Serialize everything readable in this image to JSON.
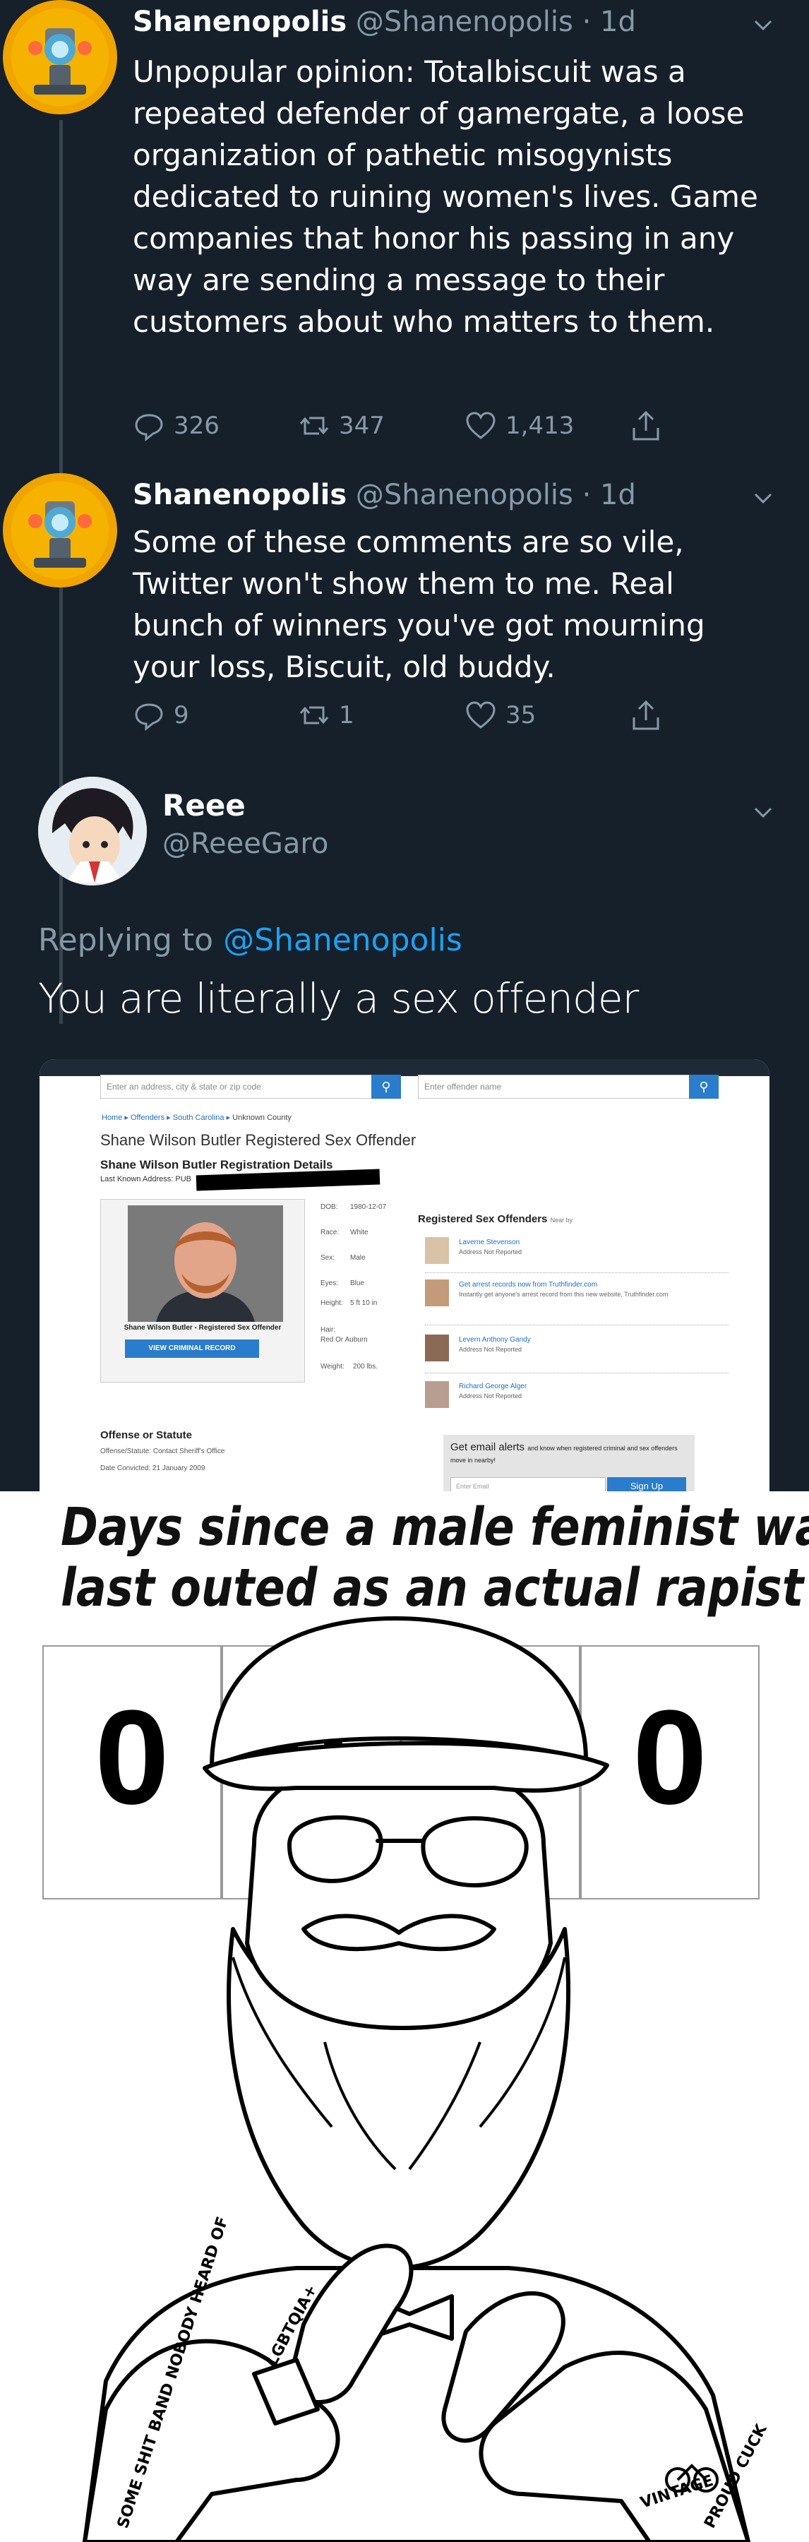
{
  "tweets": [
    {
      "name": "Shanenopolis",
      "handle": "@Shanenopolis",
      "time": "· 1d",
      "text": "Unpopular opinion: Totalbiscuit was a repeated defender of gamergate, a loose organization of pathetic misogynists dedicated to ruining women's lives. Game companies that honor his passing in any way are sending a message to their customers about who matters to them.",
      "replies": "326",
      "retweets": "347",
      "likes": "1,413"
    },
    {
      "name": "Shanenopolis",
      "handle": "@Shanenopolis",
      "time": "· 1d",
      "text": "Some of these comments are so vile, Twitter won't show them to me. Real bunch of winners you've got mourning your loss, Biscuit, old buddy.",
      "replies": "9",
      "retweets": "1",
      "likes": "35"
    }
  ],
  "reply": {
    "name": "Reee",
    "handle": "@ReeeGaro",
    "replying_prefix": "Replying to",
    "replying_to": "@Shanenopolis",
    "text": "You are literally a sex offender"
  },
  "embed": {
    "search_placeholder": "Enter an address, city & state or zip code",
    "offender_placeholder": "Enter offender name",
    "breadcrumb": [
      "Home",
      "Offenders",
      "South Carolina",
      "Unknown County"
    ],
    "heading": "Shane Wilson Butler Registered Sex Offender",
    "subheading": "Shane Wilson Butler Registration Details",
    "last_known": "Last Known Address: PUB",
    "photo_caption": "Shane Wilson Butler - Registered Sex Offender",
    "view_record": "VIEW CRIMINAL RECORD",
    "details": [
      {
        "k": "DOB:",
        "v": "1980-12-07"
      },
      {
        "k": "Race:",
        "v": "White"
      },
      {
        "k": "Sex:",
        "v": "Male"
      },
      {
        "k": "Eyes:",
        "v": "Blue"
      },
      {
        "k": "Height:",
        "v": "5 ft 10 in"
      },
      {
        "k": "Hair:",
        "v": "Red Or Auburn"
      },
      {
        "k": "Weight:",
        "v": "200 lbs."
      }
    ],
    "rso_title": "Registered Sex Offenders",
    "rso_near": "Near by",
    "rso_items": [
      {
        "name": "Laverne Stevenson",
        "sub": "Address Not Reported"
      },
      {
        "name": "Get arrest records now from Truthfinder.com",
        "sub": "Instantly get anyone's arrest record from this new website, Truthfinder.com"
      },
      {
        "name": "Levern Anthony Gandy",
        "sub": "Address Not Reported"
      },
      {
        "name": "Richard George Alger",
        "sub": "Address Not Reported"
      }
    ],
    "offense_title": "Offense or Statute",
    "offense_line": "Offense/Statute:   Contact Sheriff's Office",
    "date_line": "Date Convicted:   21 January 2009",
    "alert_title": "Get email alerts",
    "alert_sub": "and know when registered criminal and sex offenders move in nearby!",
    "email_placeholder": "Enter Email",
    "signup": "Sign Up"
  },
  "meme": {
    "title_line1": "Days since a male feminist was",
    "title_line2": "last outed as an actual rapist",
    "digits": [
      "0",
      "0",
      "0",
      "0"
    ],
    "tattoos": [
      "SOME SHIT BAND NOBODY HEARD OF",
      "LGBTQIA+",
      "VINTAGE",
      "PROUD CUCK"
    ]
  }
}
